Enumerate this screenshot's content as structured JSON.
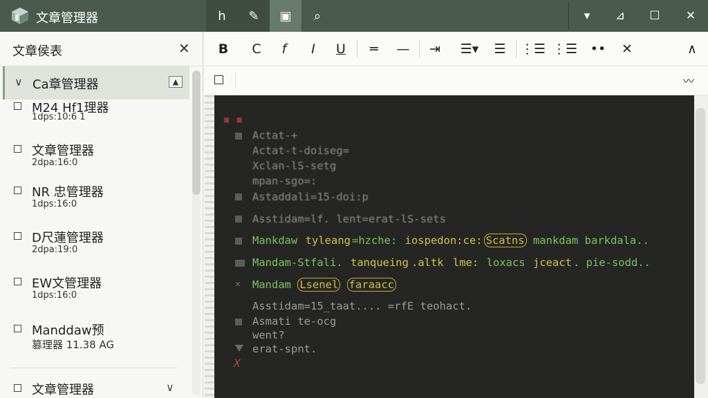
{
  "app": {
    "title": "文章管理器"
  },
  "titlebar": {
    "tools": [
      {
        "name": "text-tool",
        "glyph": "h"
      },
      {
        "name": "pen-tool",
        "glyph": "✎"
      },
      {
        "name": "shapes-tool",
        "glyph": "▣"
      },
      {
        "name": "search-tool",
        "glyph": "⌕"
      }
    ],
    "window": {
      "menu": "▾",
      "pin": "⊿",
      "maximize": "☐",
      "close": "✕"
    }
  },
  "sidebar": {
    "title": "文章侯表",
    "close_glyph": "✕",
    "group": {
      "label": "Ca章管理器",
      "chevron": "∨",
      "collapse": "▲"
    },
    "items": [
      {
        "name": "M24 Hf1理器",
        "meta": "1dps:10:6 1"
      },
      {
        "name": "文章管理器",
        "meta": "2dpa:16:0"
      },
      {
        "name": "NR 忠管理器",
        "meta": "1dps:16:0"
      },
      {
        "name": "D尺蓮管理器",
        "meta": "2dpa:19:0"
      },
      {
        "name": "EW文管理器",
        "meta": "1dps:16:0"
      },
      {
        "name": "Manddaw预",
        "meta": "篡理器 11.38 AG"
      }
    ],
    "bottom": {
      "label": "文章管理器",
      "chevron": "∨"
    }
  },
  "format_toolbar": {
    "buttons": [
      {
        "name": "bold",
        "glyph": "B"
      },
      {
        "name": "c",
        "glyph": "C"
      },
      {
        "name": "italic",
        "glyph": "f"
      },
      {
        "name": "slant",
        "glyph": "I"
      },
      {
        "name": "underline",
        "glyph": "U"
      },
      {
        "name": "rule-1",
        "glyph": "═"
      },
      {
        "name": "rule-2",
        "glyph": "—"
      },
      {
        "name": "indent",
        "glyph": "⇥"
      },
      {
        "name": "align-menu",
        "glyph": "☰▾"
      },
      {
        "name": "align",
        "glyph": "☰"
      },
      {
        "name": "list-1",
        "glyph": "⋮☰"
      },
      {
        "name": "list-2",
        "glyph": "⋮☰"
      },
      {
        "name": "more",
        "glyph": "••"
      },
      {
        "name": "clear",
        "glyph": "✕"
      },
      {
        "name": "collapse",
        "glyph": "∧"
      }
    ]
  },
  "subbar": {
    "left_glyph": "☐",
    "right_glyph": "〰"
  },
  "editor": {
    "red_dots": "■ ■",
    "lines": [
      {
        "text": "Actat-+",
        "style": "dim"
      },
      {
        "text": "Actat-t-doiseg=",
        "style": "dim"
      },
      {
        "text": "Xclan-lS-setg",
        "style": "dim"
      },
      {
        "text": "mpan-sgo=:",
        "style": "dim"
      },
      {
        "text": "Astaddali=15-doi:p",
        "style": "dim"
      },
      {
        "text": "Asstidam=lf. lent=erat-lS-sets",
        "style": "dim"
      },
      {
        "text_parts": [
          "Mankdaw ",
          "tyleang",
          "=hzche: ",
          "iospedon:ce:",
          "Scatns",
          " mankdam barkdala.."
        ],
        "style": "green"
      },
      {
        "text_parts": [
          "Mandam",
          "-Stfali.",
          " tanqueing",
          ".altk",
          " lme:",
          " loxacs",
          " jceact",
          ". pie-sodd.."
        ],
        "style": "green"
      },
      {
        "text_parts": [
          "Mandam ",
          "Lsenel",
          " ",
          "faraacc"
        ],
        "style": "green"
      },
      {
        "text": "Asstidam=15_taat.... =rfE teohact.",
        "style": "faint"
      },
      {
        "text": "Asmati te-ocg",
        "style": "faint"
      },
      {
        "text": "went?",
        "style": "faint"
      },
      {
        "text": "erat-spnt.",
        "style": "faint"
      }
    ],
    "red_x": "X"
  }
}
